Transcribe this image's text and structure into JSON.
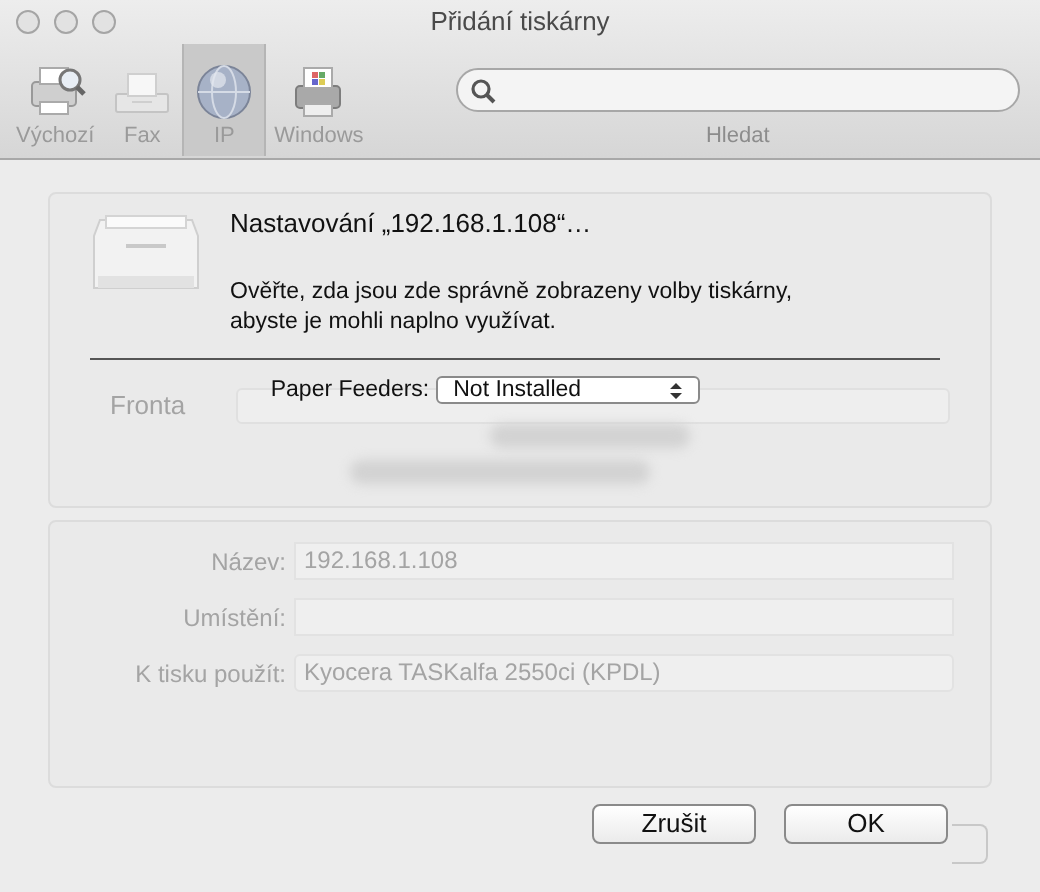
{
  "window": {
    "title": "Přidání tiskárny"
  },
  "toolbar": {
    "items": [
      {
        "label": "Výchozí",
        "kind": "default",
        "selected": false
      },
      {
        "label": "Fax",
        "kind": "fax",
        "selected": false
      },
      {
        "label": "IP",
        "kind": "ip",
        "selected": true
      },
      {
        "label": "Windows",
        "kind": "windows",
        "selected": false
      }
    ],
    "search": {
      "label": "Hledat"
    }
  },
  "background": {
    "queue_label": "Fronta",
    "fields": [
      {
        "label": "Název:",
        "value": "192.168.1.108",
        "kind": "text"
      },
      {
        "label": "Umístění:",
        "kind": "text"
      },
      {
        "label": "K tisku použít:",
        "value": "Kyocera TASKalfa 2550ci (KPDL)",
        "kind": "popup"
      }
    ]
  },
  "sheet": {
    "title": "Nastavování „192.168.1.108“…",
    "message": "Ověřte, zda jsou zde správně zobrazeny volby tiskárny, abyste je mohli naplno využívat.",
    "option": {
      "label": "Paper Feeders:",
      "value": "Not Installed"
    },
    "buttons": [
      "Zrušit",
      "OK"
    ]
  }
}
